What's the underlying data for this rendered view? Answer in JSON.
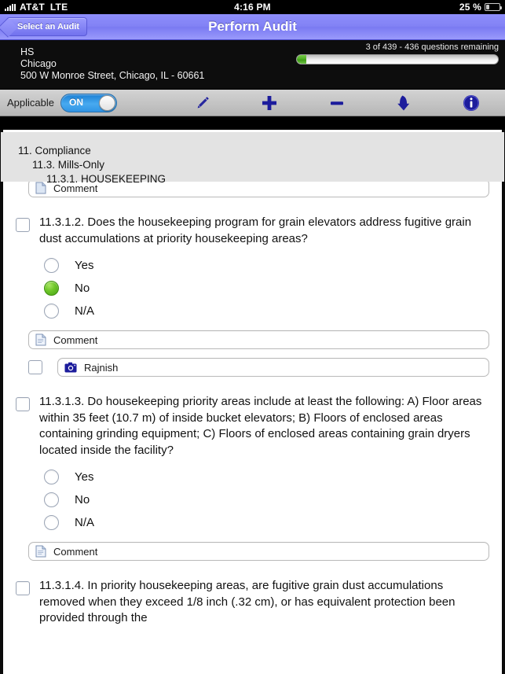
{
  "status_bar": {
    "carrier": "AT&T",
    "network": "LTE",
    "time": "4:16 PM",
    "battery_percent": "25 %",
    "signal_icon": "signal-bars-icon",
    "battery_icon": "battery-icon"
  },
  "nav_bar": {
    "back_label": "Select an Audit",
    "title": "Perform Audit"
  },
  "audit_header": {
    "site_name": "HS",
    "site_city": "Chicago",
    "site_address": "500 W Monroe Street, Chicago, IL - 60661",
    "progress_text": "3 of 439 - 436 questions remaining",
    "progress_percent": 0.7,
    "progress_fill_color": "#4fb024"
  },
  "toolbar": {
    "applicable_label": "Applicable",
    "toggle_value": "ON",
    "toggle_on_color": "#2f93e4",
    "tools": [
      {
        "name": "pencil-icon",
        "label": "Pencil"
      },
      {
        "name": "plus-icon",
        "label": "Plus"
      },
      {
        "name": "minus-icon",
        "label": "Minus"
      },
      {
        "name": "down-arrow-icon",
        "label": "Jump Down"
      },
      {
        "name": "info-icon",
        "label": "Info"
      }
    ],
    "icon_color": "#1c1c9c"
  },
  "breadcrumbs": {
    "level1": "11. Compliance",
    "level2": "11.3. Mills-Only",
    "level3": "11.3.1. HOUSEKEEPING"
  },
  "questions": [
    {
      "id": "q-partial-top",
      "text": "",
      "comment_label": "Comment",
      "comment_icon": "document-icon"
    },
    {
      "id": "11.3.1.2",
      "text": "11.3.1.2. Does the housekeeping program for grain elevators address fugitive grain dust accumulations at priority housekeeping areas?",
      "options": [
        {
          "label": "Yes",
          "selected": false
        },
        {
          "label": "No",
          "selected": true
        },
        {
          "label": "N/A",
          "selected": false
        }
      ],
      "comment_label": "Comment",
      "comment_icon": "document-icon",
      "photo_label": "Rajnish",
      "photo_icon": "camera-icon"
    },
    {
      "id": "11.3.1.3",
      "text": "11.3.1.3. Do housekeeping priority areas include at least the following:  A)  Floor areas within 35 feet (10.7 m) of inside bucket elevators;  B)  Floors of enclosed areas containing grinding equipment;  C)  Floors of enclosed areas containing grain dryers located inside the facility?",
      "options": [
        {
          "label": "Yes",
          "selected": false
        },
        {
          "label": "No",
          "selected": false
        },
        {
          "label": "N/A",
          "selected": false
        }
      ],
      "comment_label": "Comment",
      "comment_icon": "document-icon"
    },
    {
      "id": "11.3.1.4",
      "text": "11.3.1.4. In priority housekeeping areas, are fugitive grain dust accumulations removed when they exceed 1/8 inch (.32 cm), or has equivalent protection been provided through the"
    }
  ]
}
